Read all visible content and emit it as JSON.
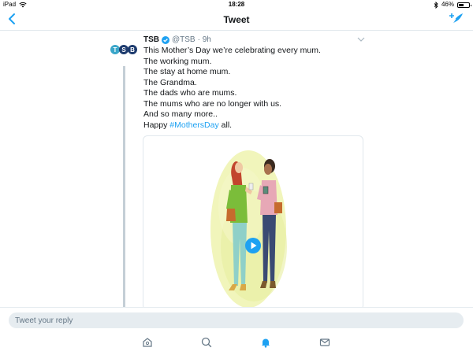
{
  "status_bar": {
    "device": "iPad",
    "time": "18:28",
    "battery": "46%",
    "battery_level": 0.46
  },
  "nav": {
    "title": "Tweet",
    "back_icon": "chevron-left-icon",
    "compose_icon": "compose-tweet-icon"
  },
  "tweet": {
    "name": "TSB",
    "handle": "@TSB",
    "time": "· 9h",
    "avatar_text": "TSB",
    "lines": [
      "This Mother’s Day we’re celebrating every mum.",
      "The working mum.",
      "The stay at home mum.",
      "The Grandma.",
      "The dads who are mums.",
      "The mums who are no longer with us.",
      "And so many more.."
    ],
    "last_line_prefix": "Happy ",
    "hashtag": "#MothersDay",
    "last_line_suffix": " all."
  },
  "reply": {
    "placeholder": "Tweet your reply"
  },
  "tabs": [
    "home-icon",
    "search-icon",
    "notifications-icon",
    "messages-icon"
  ],
  "colors": {
    "accent": "#1da1f2",
    "avatar_teal": "#3aa6c9",
    "avatar_navy": "#1d3b6e"
  }
}
